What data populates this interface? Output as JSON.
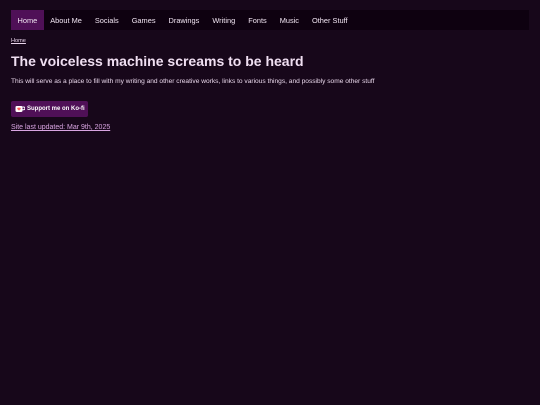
{
  "nav": {
    "items": [
      {
        "label": "Home",
        "active": true
      },
      {
        "label": "About Me"
      },
      {
        "label": "Socials"
      },
      {
        "label": "Games"
      },
      {
        "label": "Drawings"
      },
      {
        "label": "Writing"
      },
      {
        "label": "Fonts"
      },
      {
        "label": "Music"
      },
      {
        "label": "Other Stuff"
      }
    ]
  },
  "breadcrumb": {
    "label": "Home"
  },
  "main": {
    "title": "The voiceless machine screams to be heard",
    "description": "This will serve as a place to fill with my writing and other creative works, links to various things, and possibly some other stuff",
    "kofi_label": "Support me on Ko-fi",
    "kofi_icon": "kofi-cup-icon",
    "updated": "Site last updated: Mar 9th, 2025"
  },
  "colors": {
    "background": "#17071a",
    "nav_background": "#0e0110",
    "accent": "#4f1057",
    "link": "#d9a5e2"
  }
}
